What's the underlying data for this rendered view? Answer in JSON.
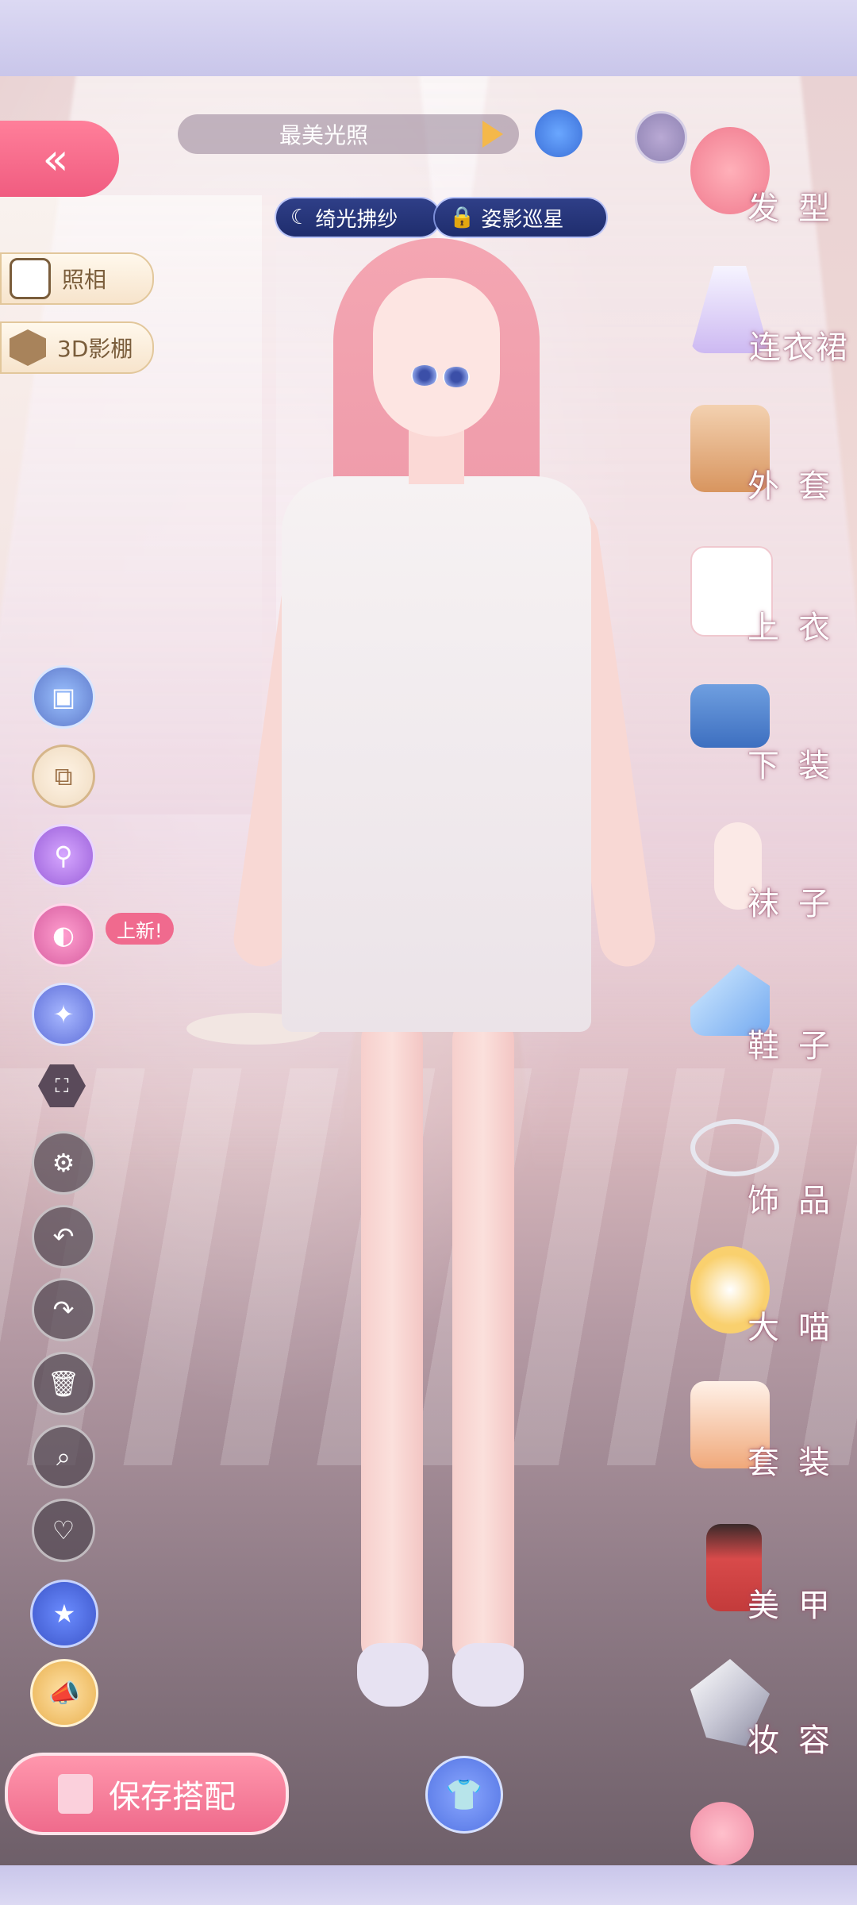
{
  "header": {
    "outfit_name": "最美光照",
    "tags": [
      {
        "label": "绮光拂纱",
        "icon": "moon-icon"
      },
      {
        "label": "姿影巡星",
        "icon": "lock-icon"
      }
    ]
  },
  "left_panel": {
    "back_icon": "double-chevron-left-icon",
    "photo_label": "照相",
    "studio_label": "3D影棚",
    "new_badge": "上新!",
    "tools": [
      "clip-icon",
      "copy-icon",
      "zoom-icon",
      "palette-icon",
      "magic-icon",
      "frame-icon",
      "gear-icon",
      "undo-icon",
      "redo-icon",
      "trash-icon",
      "search-icon",
      "heart-icon",
      "favorite-icon",
      "horn-icon"
    ]
  },
  "footer": {
    "save_label": "保存搭配",
    "wardrobe_icon": "wardrobe-icon"
  },
  "categories": [
    {
      "label": "发型"
    },
    {
      "label": "连衣裙"
    },
    {
      "label": "外套"
    },
    {
      "label": "上衣"
    },
    {
      "label": "下装"
    },
    {
      "label": "袜子"
    },
    {
      "label": "鞋子"
    },
    {
      "label": "饰品"
    },
    {
      "label": "大喵"
    },
    {
      "label": "套装"
    },
    {
      "label": "美甲"
    },
    {
      "label": "妆容"
    }
  ],
  "colors": {
    "accent_pink": "#f05c80",
    "tag_navy": "#1f2d6d",
    "gold": "#e9b04e"
  }
}
